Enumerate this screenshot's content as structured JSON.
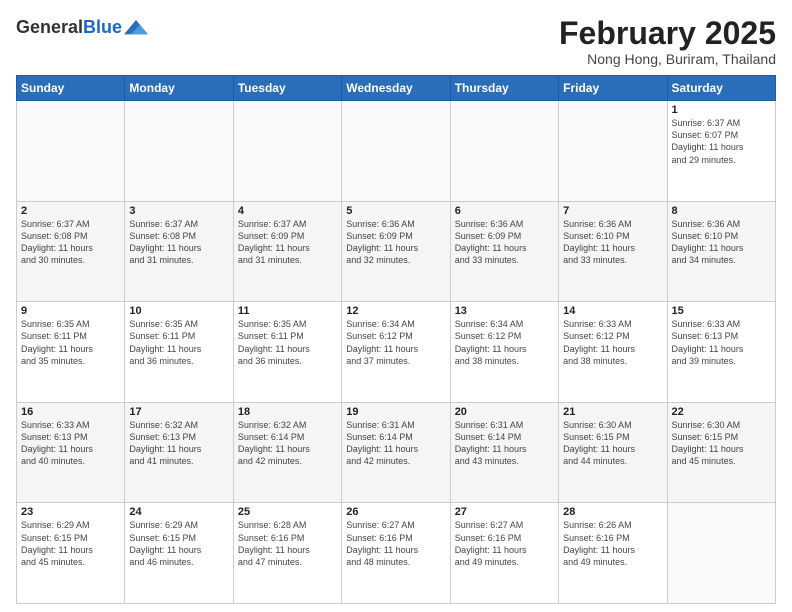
{
  "header": {
    "logo_general": "General",
    "logo_blue": "Blue",
    "title": "February 2025",
    "subtitle": "Nong Hong, Buriram, Thailand"
  },
  "weekdays": [
    "Sunday",
    "Monday",
    "Tuesday",
    "Wednesday",
    "Thursday",
    "Friday",
    "Saturday"
  ],
  "weeks": [
    [
      {
        "day": "",
        "info": ""
      },
      {
        "day": "",
        "info": ""
      },
      {
        "day": "",
        "info": ""
      },
      {
        "day": "",
        "info": ""
      },
      {
        "day": "",
        "info": ""
      },
      {
        "day": "",
        "info": ""
      },
      {
        "day": "1",
        "info": "Sunrise: 6:37 AM\nSunset: 6:07 PM\nDaylight: 11 hours\nand 29 minutes."
      }
    ],
    [
      {
        "day": "2",
        "info": "Sunrise: 6:37 AM\nSunset: 6:08 PM\nDaylight: 11 hours\nand 30 minutes."
      },
      {
        "day": "3",
        "info": "Sunrise: 6:37 AM\nSunset: 6:08 PM\nDaylight: 11 hours\nand 31 minutes."
      },
      {
        "day": "4",
        "info": "Sunrise: 6:37 AM\nSunset: 6:09 PM\nDaylight: 11 hours\nand 31 minutes."
      },
      {
        "day": "5",
        "info": "Sunrise: 6:36 AM\nSunset: 6:09 PM\nDaylight: 11 hours\nand 32 minutes."
      },
      {
        "day": "6",
        "info": "Sunrise: 6:36 AM\nSunset: 6:09 PM\nDaylight: 11 hours\nand 33 minutes."
      },
      {
        "day": "7",
        "info": "Sunrise: 6:36 AM\nSunset: 6:10 PM\nDaylight: 11 hours\nand 33 minutes."
      },
      {
        "day": "8",
        "info": "Sunrise: 6:36 AM\nSunset: 6:10 PM\nDaylight: 11 hours\nand 34 minutes."
      }
    ],
    [
      {
        "day": "9",
        "info": "Sunrise: 6:35 AM\nSunset: 6:11 PM\nDaylight: 11 hours\nand 35 minutes."
      },
      {
        "day": "10",
        "info": "Sunrise: 6:35 AM\nSunset: 6:11 PM\nDaylight: 11 hours\nand 36 minutes."
      },
      {
        "day": "11",
        "info": "Sunrise: 6:35 AM\nSunset: 6:11 PM\nDaylight: 11 hours\nand 36 minutes."
      },
      {
        "day": "12",
        "info": "Sunrise: 6:34 AM\nSunset: 6:12 PM\nDaylight: 11 hours\nand 37 minutes."
      },
      {
        "day": "13",
        "info": "Sunrise: 6:34 AM\nSunset: 6:12 PM\nDaylight: 11 hours\nand 38 minutes."
      },
      {
        "day": "14",
        "info": "Sunrise: 6:33 AM\nSunset: 6:12 PM\nDaylight: 11 hours\nand 38 minutes."
      },
      {
        "day": "15",
        "info": "Sunrise: 6:33 AM\nSunset: 6:13 PM\nDaylight: 11 hours\nand 39 minutes."
      }
    ],
    [
      {
        "day": "16",
        "info": "Sunrise: 6:33 AM\nSunset: 6:13 PM\nDaylight: 11 hours\nand 40 minutes."
      },
      {
        "day": "17",
        "info": "Sunrise: 6:32 AM\nSunset: 6:13 PM\nDaylight: 11 hours\nand 41 minutes."
      },
      {
        "day": "18",
        "info": "Sunrise: 6:32 AM\nSunset: 6:14 PM\nDaylight: 11 hours\nand 42 minutes."
      },
      {
        "day": "19",
        "info": "Sunrise: 6:31 AM\nSunset: 6:14 PM\nDaylight: 11 hours\nand 42 minutes."
      },
      {
        "day": "20",
        "info": "Sunrise: 6:31 AM\nSunset: 6:14 PM\nDaylight: 11 hours\nand 43 minutes."
      },
      {
        "day": "21",
        "info": "Sunrise: 6:30 AM\nSunset: 6:15 PM\nDaylight: 11 hours\nand 44 minutes."
      },
      {
        "day": "22",
        "info": "Sunrise: 6:30 AM\nSunset: 6:15 PM\nDaylight: 11 hours\nand 45 minutes."
      }
    ],
    [
      {
        "day": "23",
        "info": "Sunrise: 6:29 AM\nSunset: 6:15 PM\nDaylight: 11 hours\nand 45 minutes."
      },
      {
        "day": "24",
        "info": "Sunrise: 6:29 AM\nSunset: 6:15 PM\nDaylight: 11 hours\nand 46 minutes."
      },
      {
        "day": "25",
        "info": "Sunrise: 6:28 AM\nSunset: 6:16 PM\nDaylight: 11 hours\nand 47 minutes."
      },
      {
        "day": "26",
        "info": "Sunrise: 6:27 AM\nSunset: 6:16 PM\nDaylight: 11 hours\nand 48 minutes."
      },
      {
        "day": "27",
        "info": "Sunrise: 6:27 AM\nSunset: 6:16 PM\nDaylight: 11 hours\nand 49 minutes."
      },
      {
        "day": "28",
        "info": "Sunrise: 6:26 AM\nSunset: 6:16 PM\nDaylight: 11 hours\nand 49 minutes."
      },
      {
        "day": "",
        "info": ""
      }
    ]
  ]
}
